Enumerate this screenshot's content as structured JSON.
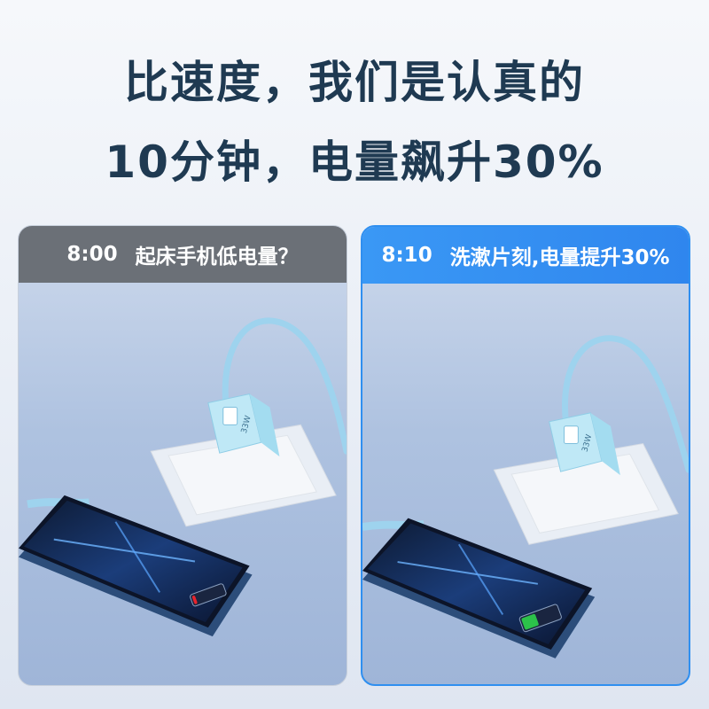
{
  "headline": {
    "line1": "比速度，我们是认真的",
    "line2": "10分钟，电量飙升30%"
  },
  "panels": [
    {
      "time": "8:00",
      "caption": "起床手机低电量？",
      "battery_level": 0.1,
      "battery_color": "#e8242c"
    },
    {
      "time": "8:10",
      "caption": "洗漱片刻,电量提升30%",
      "battery_level": 0.4,
      "battery_color": "#2cc24a"
    }
  ],
  "charger": {
    "label": "33W"
  },
  "colors": {
    "headline": "#1f3a52",
    "accent": "#2f8ff0",
    "left_header": "#6b7077",
    "cable": "#9ed3ee"
  }
}
